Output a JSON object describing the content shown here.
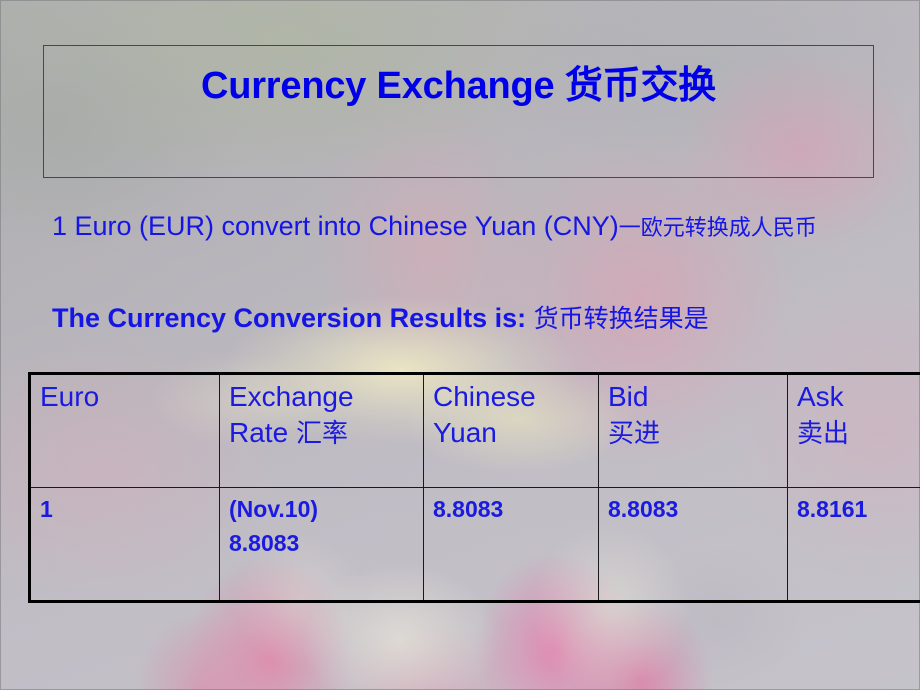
{
  "slide": {
    "title_en": "Currency Exchange ",
    "title_cn": "货币交换",
    "accent_blue": "#0000e8",
    "border_blue": "#3333ee",
    "table_border": "#000000"
  },
  "body": {
    "line1_en": "1 Euro (EUR) convert into Chinese Yuan (CNY)",
    "line1_cn": "一欧元转换成人民币",
    "line2_en": "The Currency Conversion Results is: ",
    "line2_cn": "货币转换结果是"
  },
  "table": {
    "headers": [
      {
        "en": "Euro",
        "cn": ""
      },
      {
        "en": "Exchange Rate ",
        "cn": "汇率"
      },
      {
        "en": "Chinese Yuan",
        "cn": ""
      },
      {
        "en": "Bid",
        "cn": "买进"
      },
      {
        "en": "Ask",
        "cn": "卖出"
      }
    ],
    "rows": [
      {
        "euro": "1",
        "rate_date": "(Nov.10)",
        "rate_value": "8.8083",
        "chinese_yuan": "8.8083",
        "bid": "8.8083",
        "ask": "8.8161"
      }
    ]
  }
}
